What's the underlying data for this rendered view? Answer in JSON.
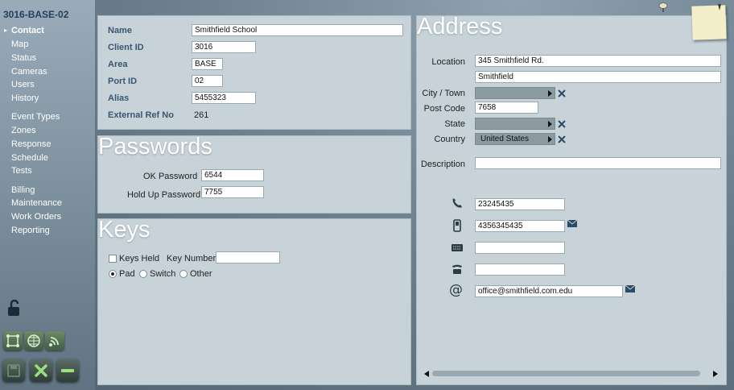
{
  "site": {
    "title": "3016-BASE-02"
  },
  "nav": [
    "Contact",
    "Map",
    "Status",
    "Cameras",
    "Users",
    "History",
    "Event Types",
    "Zones",
    "Response",
    "Schedule",
    "Tests",
    "Billing",
    "Maintenance",
    "Work Orders",
    "Reporting"
  ],
  "details": {
    "name_label": "Name",
    "name_value": "Smithfield School",
    "client_id_label": "Client ID",
    "client_id_value": "3016",
    "area_label": "Area",
    "area_value": "BASE",
    "port_id_label": "Port ID",
    "port_id_value": "02",
    "alias_label": "Alias",
    "alias_value": "5455323",
    "external_ref_label": "External Ref No",
    "external_ref_value": "261"
  },
  "passwords": {
    "title": "Passwords",
    "ok_label": "OK Password",
    "ok_value": "6544",
    "holdup_label": "Hold Up Password",
    "holdup_value": "7755"
  },
  "keys": {
    "title": "Keys",
    "keys_held_label": "Keys Held",
    "keys_held_checked": false,
    "key_number_label": "Key Number",
    "key_number_value": "",
    "options": [
      "Pad",
      "Switch",
      "Other"
    ],
    "selected": "Pad"
  },
  "address": {
    "title": "Address",
    "location_label": "Location",
    "location_line1": "345 Smithfield Rd.",
    "location_line2": "Smithfield",
    "city_label": "City / Town",
    "city_value": "",
    "postcode_label": "Post Code",
    "postcode_value": "7658",
    "state_label": "State",
    "state_value": "",
    "country_label": "Country",
    "country_value": "United States",
    "description_label": "Description",
    "description_value": ""
  },
  "contact": {
    "phone": "23245435",
    "mobile": "4356345435",
    "fax": "",
    "other_phone": "",
    "email": "office@smithfield.com.edu"
  },
  "icons": [
    "lock-open-icon",
    "zones-icon",
    "map-grid-icon",
    "signal-icon",
    "save-icon",
    "cancel-icon",
    "remove-icon",
    "phone-icon",
    "mobile-icon",
    "fax-icon",
    "desk-phone-icon",
    "at-icon",
    "envelope-icon",
    "clear-icon",
    "pin-icon",
    "sticky-note-icon"
  ],
  "colors": {
    "panel": "#c7d3d9",
    "accent": "#23415e",
    "green_tile": "#3f5c45"
  }
}
